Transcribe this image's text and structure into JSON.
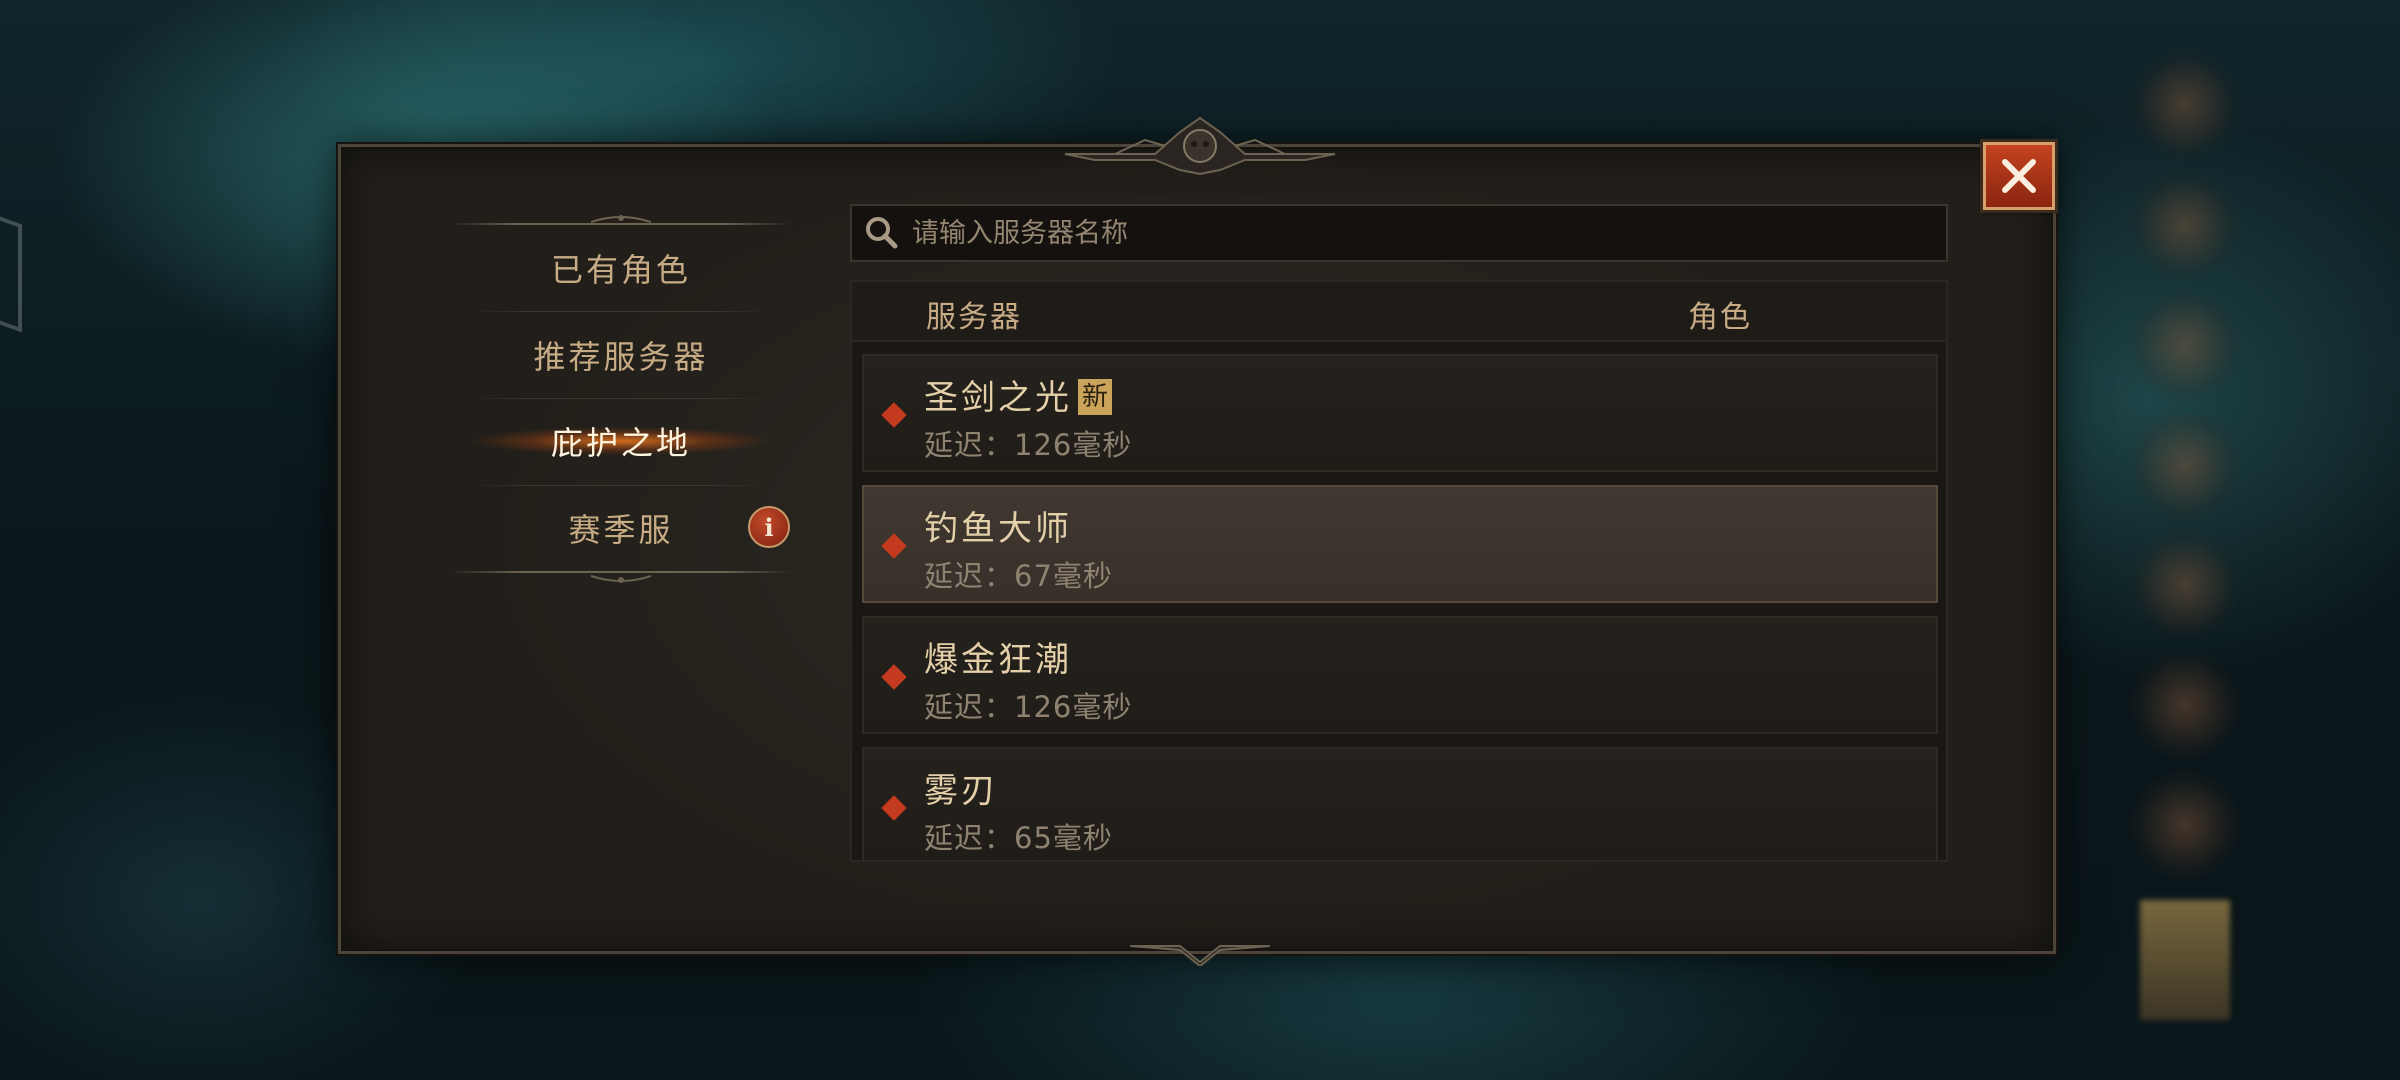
{
  "dialog": {
    "close_icon": "close-x-icon"
  },
  "sidebar": {
    "items": [
      {
        "label": "已有角色"
      },
      {
        "label": "推荐服务器"
      },
      {
        "label": "庇护之地",
        "active": true
      },
      {
        "label": "赛季服",
        "badge_icon": "info-icon",
        "badge_text": "i"
      }
    ]
  },
  "search": {
    "placeholder": "请输入服务器名称",
    "icon": "search-icon"
  },
  "list": {
    "columns": {
      "server": "服务器",
      "role": "角色"
    },
    "rows": [
      {
        "name": "圣剑之光",
        "badge": "新",
        "latency": "延迟：126毫秒"
      },
      {
        "name": "钓鱼大师",
        "badge": null,
        "latency": "延迟：67毫秒",
        "selected": true
      },
      {
        "name": "爆金狂潮",
        "badge": null,
        "latency": "延迟：126毫秒"
      },
      {
        "name": "雾刃",
        "badge": null,
        "latency": "延迟：65毫秒"
      }
    ]
  },
  "colors": {
    "accent": "#c33a1e",
    "active_glow": "#f07820",
    "text_gold": "#c7ab85"
  }
}
